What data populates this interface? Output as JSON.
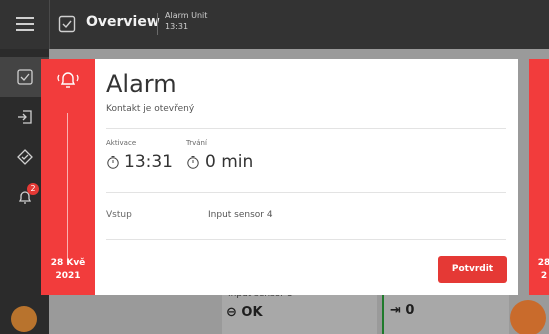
{
  "header": {
    "title": "Overview",
    "unit_name": "Alarm Unit",
    "time": "13:31"
  },
  "sidebar": {
    "items": [
      {
        "icon": "overview-icon",
        "active": true
      },
      {
        "icon": "door-exit-icon",
        "active": false
      },
      {
        "icon": "overview-icon",
        "active": false
      },
      {
        "icon": "bell-icon",
        "active": false,
        "badge": "2"
      }
    ]
  },
  "background": {
    "card1_label": "Input sensor 8",
    "card1_value": "OK",
    "card2_value": "0"
  },
  "alarm": {
    "title": "Alarm",
    "subtitle": "Kontakt je otevřený",
    "activation_label": "Aktivace",
    "activation_value": "13:31",
    "duration_label": "Trvání",
    "duration_value": "0 min",
    "input_label": "Vstup",
    "input_value": "Input sensor 4",
    "confirm_label": "Potvrdit",
    "date_day": "28 Kvě",
    "date_year": "2021",
    "next_date_day": "28",
    "next_date_year": "2"
  },
  "colors": {
    "accent_red": "#f23c3c",
    "topbar": "#333333",
    "sidebar": "#2b2b2b"
  }
}
